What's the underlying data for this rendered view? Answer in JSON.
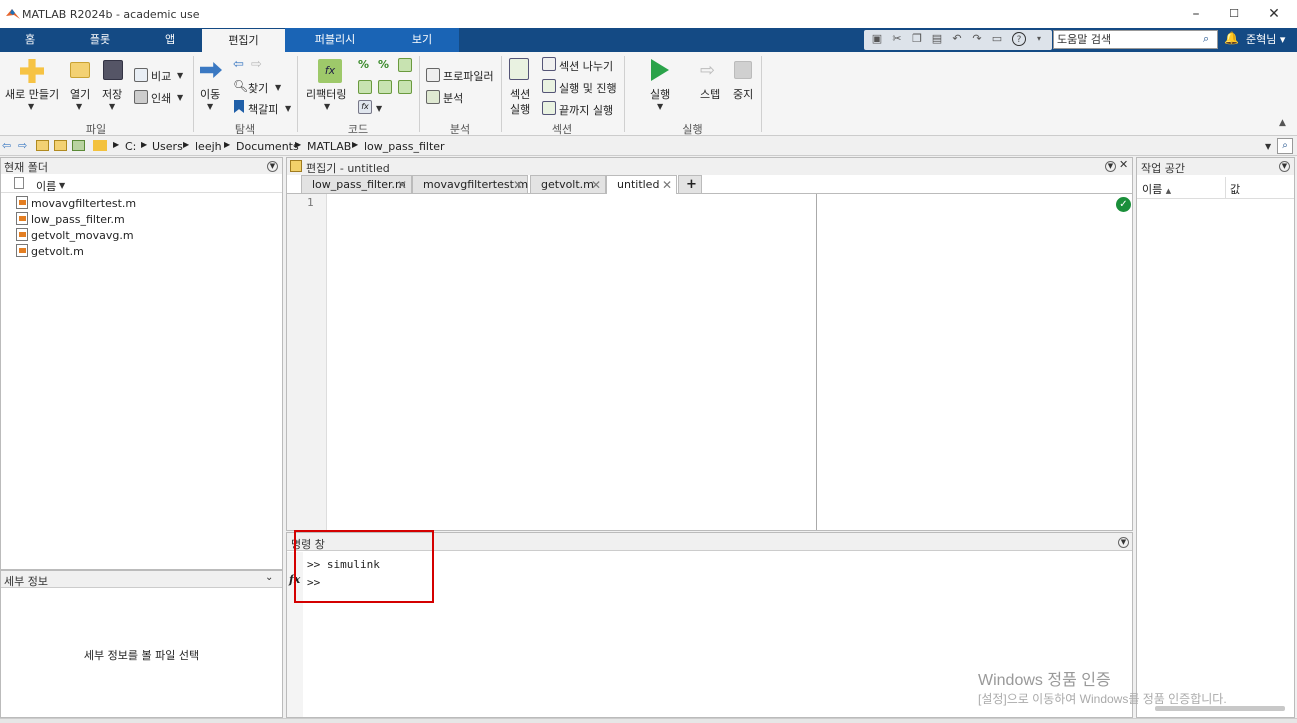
{
  "window": {
    "title": "MATLAB R2024b - academic use"
  },
  "tabs": [
    {
      "label": "홈"
    },
    {
      "label": "플롯"
    },
    {
      "label": "앱"
    },
    {
      "label": "편집기"
    },
    {
      "label": "퍼블리시"
    },
    {
      "label": "보기"
    }
  ],
  "search": {
    "placeholder": "도움말 검색",
    "value": "도움말 검색"
  },
  "user": {
    "name": "준혁님"
  },
  "ribbon": {
    "file": {
      "new": "새로 만들기",
      "open": "열기",
      "save": "저장",
      "compare": "비교",
      "print": "인쇄",
      "group": "파일"
    },
    "navigate": {
      "goto": "이동",
      "find": "찾기",
      "bookmark": "책갈피",
      "group": "탐색"
    },
    "code": {
      "refactor": "리팩터링",
      "group": "코드"
    },
    "analyze": {
      "profiler": "프로파일러",
      "analyze": "분석",
      "group": "분석"
    },
    "section": {
      "run_section_1": "섹션",
      "run_section_2": "실행",
      "break": "섹션 나누기",
      "run_advance": "실행 및 진행",
      "run_to_end": "끝까지 실행",
      "group": "섹션"
    },
    "run": {
      "run": "실행",
      "step": "스텝",
      "stop": "중지",
      "group": "실행"
    }
  },
  "address": {
    "crumbs": [
      "C:",
      "Users",
      "leejh",
      "Documents",
      "MATLAB",
      "low_pass_filter"
    ]
  },
  "current_folder": {
    "title": "현재 폴더",
    "column": "이름",
    "files": [
      "movavgfiltertest.m",
      "low_pass_filter.m",
      "getvolt_movavg.m",
      "getvolt.m"
    ]
  },
  "details": {
    "title": "세부 정보",
    "empty": "세부 정보를 볼 파일 선택"
  },
  "editor": {
    "title": "편집기 - untitled",
    "tabs": [
      "low_pass_filter.m",
      "movavgfiltertest.m",
      "getvolt.m",
      "untitled"
    ],
    "add_tab": "+",
    "line_number": "1"
  },
  "command_window": {
    "title": "명령 창",
    "lines": [
      ">> simulink",
      ">>"
    ],
    "fx": "fx"
  },
  "workspace": {
    "title": "작업 공간",
    "col_name": "이름",
    "col_value": "값"
  },
  "watermark": {
    "line1": "Windows 정품 인증",
    "line2": "[설정]으로 이동하여 Windows를 정품 인증합니다."
  },
  "colors": {
    "tab_bar": "#144a84",
    "highlight_box": "#d40000",
    "ok_badge": "#1a8f3a"
  }
}
